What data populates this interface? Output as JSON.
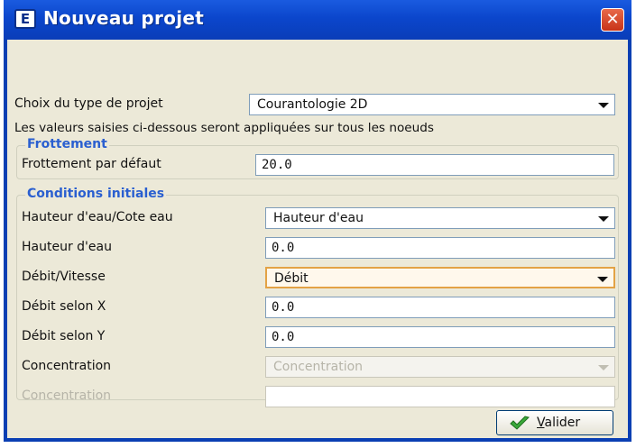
{
  "window": {
    "title": "Nouveau projet",
    "app_icon_letter": "E",
    "close_symbol": "✕"
  },
  "project_type": {
    "label": "Choix du type de projet",
    "value": "Courantologie 2D"
  },
  "info_text": "Les valeurs saisies ci-dessous seront appliquées sur tous les noeuds",
  "frottement": {
    "group_title": "Frottement",
    "label": "Frottement par défaut",
    "value": "20.0"
  },
  "conditions": {
    "group_title": "Conditions initiales",
    "hauteur_type_label": "Hauteur d'eau/Cote eau",
    "hauteur_type_value": "Hauteur d'eau",
    "hauteur_label": "Hauteur d'eau",
    "hauteur_value": "0.0",
    "debit_type_label": "Débit/Vitesse",
    "debit_type_value": "Débit",
    "debit_x_label": "Débit selon X",
    "debit_x_value": "0.0",
    "debit_y_label": "Débit selon Y",
    "debit_y_value": "0.0",
    "concentration_label": "Concentration",
    "concentration_select_value": "Concentration",
    "concentration_field_label": "Concentration",
    "concentration_field_value": ""
  },
  "actions": {
    "valider_mnemonic": "V",
    "valider_rest": "alider"
  },
  "colors": {
    "titlebar": "#0b46cc",
    "background": "#ece9d8",
    "group_title": "#2a5fd0",
    "close": "#c83318",
    "focus": "#e3a245"
  }
}
